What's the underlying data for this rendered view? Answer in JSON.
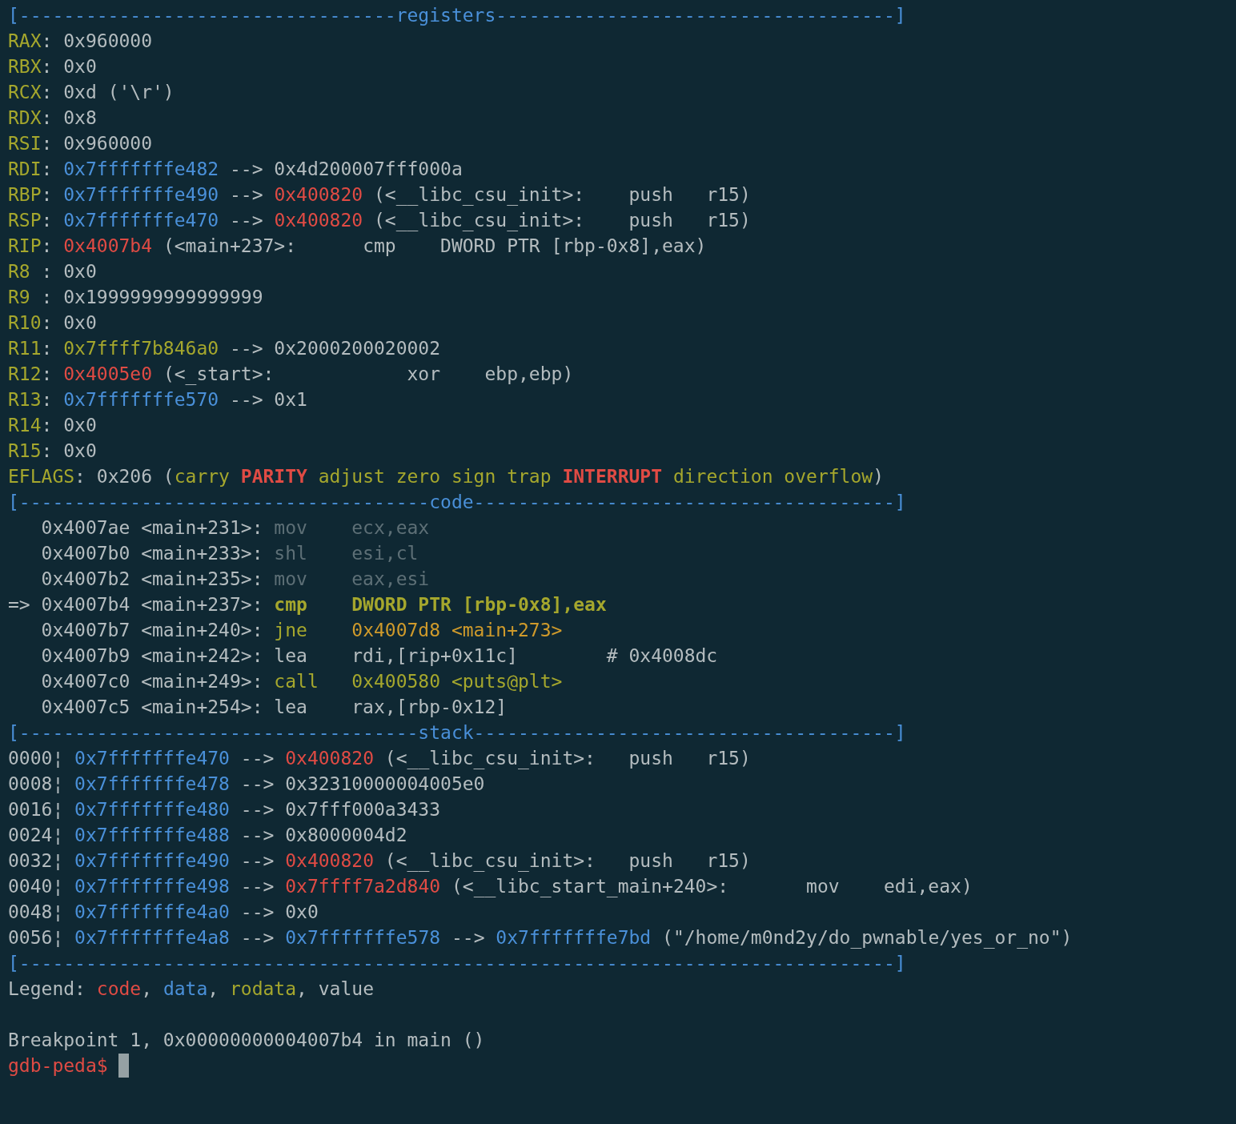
{
  "terminal": {
    "lines": [
      {
        "segments": [
          {
            "text": "[----------------------------------",
            "kind": "rule"
          },
          {
            "text": "registers",
            "kind": "rule"
          },
          {
            "text": "------------------------------------]",
            "kind": "rule"
          }
        ]
      },
      {
        "segments": [
          {
            "text": "RAX",
            "kind": "label"
          },
          {
            "text": ": 0x960000",
            "kind": "value"
          }
        ]
      },
      {
        "segments": [
          {
            "text": "RBX",
            "kind": "label"
          },
          {
            "text": ": 0x0",
            "kind": "value"
          }
        ]
      },
      {
        "segments": [
          {
            "text": "RCX",
            "kind": "label"
          },
          {
            "text": ": 0xd ('\\r')",
            "kind": "value"
          }
        ]
      },
      {
        "segments": [
          {
            "text": "RDX",
            "kind": "label"
          },
          {
            "text": ": 0x8",
            "kind": "value"
          }
        ]
      },
      {
        "segments": [
          {
            "text": "RSI",
            "kind": "label"
          },
          {
            "text": ": 0x960000",
            "kind": "value"
          }
        ]
      },
      {
        "segments": [
          {
            "text": "RDI",
            "kind": "label"
          },
          {
            "text": ": ",
            "kind": "value"
          },
          {
            "text": "0x7fffffffe482",
            "kind": "data"
          },
          {
            "text": " --> 0x4d200007fff000a",
            "kind": "value"
          }
        ]
      },
      {
        "segments": [
          {
            "text": "RBP",
            "kind": "label"
          },
          {
            "text": ": ",
            "kind": "value"
          },
          {
            "text": "0x7fffffffe490",
            "kind": "data"
          },
          {
            "text": " --> ",
            "kind": "value"
          },
          {
            "text": "0x400820",
            "kind": "code"
          },
          {
            "text": " (<__libc_csu_init>:    push   r15)",
            "kind": "value"
          }
        ]
      },
      {
        "segments": [
          {
            "text": "RSP",
            "kind": "label"
          },
          {
            "text": ": ",
            "kind": "value"
          },
          {
            "text": "0x7fffffffe470",
            "kind": "data"
          },
          {
            "text": " --> ",
            "kind": "value"
          },
          {
            "text": "0x400820",
            "kind": "code"
          },
          {
            "text": " (<__libc_csu_init>:    push   r15)",
            "kind": "value"
          }
        ]
      },
      {
        "segments": [
          {
            "text": "RIP",
            "kind": "label"
          },
          {
            "text": ": ",
            "kind": "value"
          },
          {
            "text": "0x4007b4",
            "kind": "code"
          },
          {
            "text": " (<main+237>:      cmp    DWORD PTR [rbp-0x8],eax)",
            "kind": "value"
          }
        ]
      },
      {
        "segments": [
          {
            "text": "R8 ",
            "kind": "label"
          },
          {
            "text": ": 0x0",
            "kind": "value"
          }
        ]
      },
      {
        "segments": [
          {
            "text": "R9 ",
            "kind": "label"
          },
          {
            "text": ": 0x1999999999999999",
            "kind": "value"
          }
        ]
      },
      {
        "segments": [
          {
            "text": "R10",
            "kind": "label"
          },
          {
            "text": ": 0x0",
            "kind": "value"
          }
        ]
      },
      {
        "segments": [
          {
            "text": "R11",
            "kind": "label"
          },
          {
            "text": ": ",
            "kind": "value"
          },
          {
            "text": "0x7ffff7b846a0",
            "kind": "rodata"
          },
          {
            "text": " --> 0x2000200020002",
            "kind": "value"
          }
        ]
      },
      {
        "segments": [
          {
            "text": "R12",
            "kind": "label"
          },
          {
            "text": ": ",
            "kind": "value"
          },
          {
            "text": "0x4005e0",
            "kind": "code"
          },
          {
            "text": " (<_start>:            xor    ebp,ebp)",
            "kind": "value"
          }
        ]
      },
      {
        "segments": [
          {
            "text": "R13",
            "kind": "label"
          },
          {
            "text": ": ",
            "kind": "value"
          },
          {
            "text": "0x7fffffffe570",
            "kind": "data"
          },
          {
            "text": " --> 0x1",
            "kind": "value"
          }
        ]
      },
      {
        "segments": [
          {
            "text": "R14",
            "kind": "label"
          },
          {
            "text": ": 0x0",
            "kind": "value"
          }
        ]
      },
      {
        "segments": [
          {
            "text": "R15",
            "kind": "label"
          },
          {
            "text": ": 0x0",
            "kind": "value"
          }
        ]
      },
      {
        "segments": [
          {
            "text": "EFLAGS",
            "kind": "label"
          },
          {
            "text": ": 0x206 (",
            "kind": "value"
          },
          {
            "text": "carry ",
            "kind": "rodata"
          },
          {
            "text": "PARITY ",
            "kind": "flag"
          },
          {
            "text": "adjust zero sign trap ",
            "kind": "rodata"
          },
          {
            "text": "INTERRUPT ",
            "kind": "flag"
          },
          {
            "text": "direction overflow",
            "kind": "rodata"
          },
          {
            "text": ")",
            "kind": "value"
          }
        ]
      },
      {
        "segments": [
          {
            "text": "[-------------------------------------",
            "kind": "rule"
          },
          {
            "text": "code",
            "kind": "rule"
          },
          {
            "text": "--------------------------------------]",
            "kind": "rule"
          }
        ]
      },
      {
        "segments": [
          {
            "text": "   0x4007ae <main+231>: ",
            "kind": "value"
          },
          {
            "text": "mov    ecx,eax",
            "kind": "dim"
          }
        ]
      },
      {
        "segments": [
          {
            "text": "   0x4007b0 <main+233>: ",
            "kind": "value"
          },
          {
            "text": "shl    esi,cl",
            "kind": "dim"
          }
        ]
      },
      {
        "segments": [
          {
            "text": "   0x4007b2 <main+235>: ",
            "kind": "value"
          },
          {
            "text": "mov    eax,esi",
            "kind": "dim"
          }
        ]
      },
      {
        "segments": [
          {
            "text": "=> 0x4007b4 <main+237>: ",
            "kind": "value"
          },
          {
            "text": "cmp    DWORD PTR [rbp-0x8],eax",
            "kind": "current"
          }
        ]
      },
      {
        "segments": [
          {
            "text": "   0x4007b7 <main+240>: ",
            "kind": "value"
          },
          {
            "text": "jne    ",
            "kind": "rodata"
          },
          {
            "text": "0x4007d8 <main+273>",
            "kind": "jump"
          }
        ]
      },
      {
        "segments": [
          {
            "text": "   0x4007b9 <main+242>: lea    rdi,[rip+0x11c]        # 0x4008dc",
            "kind": "value"
          }
        ]
      },
      {
        "segments": [
          {
            "text": "   0x4007c0 <main+249>: ",
            "kind": "value"
          },
          {
            "text": "call   0x400580 <puts@plt>",
            "kind": "rodata"
          }
        ]
      },
      {
        "segments": [
          {
            "text": "   0x4007c5 <main+254>: lea    rax,[rbp-0x12]",
            "kind": "value"
          }
        ]
      },
      {
        "segments": [
          {
            "text": "[------------------------------------",
            "kind": "rule"
          },
          {
            "text": "stack",
            "kind": "rule"
          },
          {
            "text": "--------------------------------------]",
            "kind": "rule"
          }
        ]
      },
      {
        "segments": [
          {
            "text": "0000¦ ",
            "kind": "value"
          },
          {
            "text": "0x7fffffffe470",
            "kind": "data"
          },
          {
            "text": " --> ",
            "kind": "value"
          },
          {
            "text": "0x400820",
            "kind": "code"
          },
          {
            "text": " (<__libc_csu_init>:   push   r15)",
            "kind": "value"
          }
        ]
      },
      {
        "segments": [
          {
            "text": "0008¦ ",
            "kind": "value"
          },
          {
            "text": "0x7fffffffe478",
            "kind": "data"
          },
          {
            "text": " --> 0x32310000004005e0",
            "kind": "value"
          }
        ]
      },
      {
        "segments": [
          {
            "text": "0016¦ ",
            "kind": "value"
          },
          {
            "text": "0x7fffffffe480",
            "kind": "data"
          },
          {
            "text": " --> 0x7fff000a3433",
            "kind": "value"
          }
        ]
      },
      {
        "segments": [
          {
            "text": "0024¦ ",
            "kind": "value"
          },
          {
            "text": "0x7fffffffe488",
            "kind": "data"
          },
          {
            "text": " --> 0x8000004d2",
            "kind": "value"
          }
        ]
      },
      {
        "segments": [
          {
            "text": "0032¦ ",
            "kind": "value"
          },
          {
            "text": "0x7fffffffe490",
            "kind": "data"
          },
          {
            "text": " --> ",
            "kind": "value"
          },
          {
            "text": "0x400820",
            "kind": "code"
          },
          {
            "text": " (<__libc_csu_init>:   push   r15)",
            "kind": "value"
          }
        ]
      },
      {
        "segments": [
          {
            "text": "0040¦ ",
            "kind": "value"
          },
          {
            "text": "0x7fffffffe498",
            "kind": "data"
          },
          {
            "text": " --> ",
            "kind": "value"
          },
          {
            "text": "0x7ffff7a2d840",
            "kind": "code"
          },
          {
            "text": " (<__libc_start_main+240>:       mov    edi,eax)",
            "kind": "value"
          }
        ]
      },
      {
        "segments": [
          {
            "text": "0048¦ ",
            "kind": "value"
          },
          {
            "text": "0x7fffffffe4a0",
            "kind": "data"
          },
          {
            "text": " --> 0x0",
            "kind": "value"
          }
        ]
      },
      {
        "segments": [
          {
            "text": "0056¦ ",
            "kind": "value"
          },
          {
            "text": "0x7fffffffe4a8",
            "kind": "data"
          },
          {
            "text": " --> ",
            "kind": "value"
          },
          {
            "text": "0x7fffffffe578",
            "kind": "data"
          },
          {
            "text": " --> ",
            "kind": "value"
          },
          {
            "text": "0x7fffffffe7bd",
            "kind": "data"
          },
          {
            "text": " (\"/home/m0nd2y/do_pwnable/yes_or_no\")",
            "kind": "value"
          }
        ]
      },
      {
        "segments": [
          {
            "text": "[-------------------------------------------------------------------------------]",
            "kind": "rule"
          }
        ]
      },
      {
        "segments": [
          {
            "text": "Legend: ",
            "kind": "value"
          },
          {
            "text": "code",
            "kind": "code"
          },
          {
            "text": ", ",
            "kind": "value"
          },
          {
            "text": "data",
            "kind": "data"
          },
          {
            "text": ", ",
            "kind": "value"
          },
          {
            "text": "rodata",
            "kind": "rodata"
          },
          {
            "text": ", value",
            "kind": "value"
          }
        ]
      },
      {
        "blank": true
      },
      {
        "segments": [
          {
            "text": "Breakpoint 1, 0x00000000004007b4 in main ()",
            "kind": "value"
          }
        ]
      },
      {
        "segments": [
          {
            "text": "gdb-peda$ ",
            "kind": "prompt"
          }
        ],
        "cursor": true
      }
    ]
  }
}
